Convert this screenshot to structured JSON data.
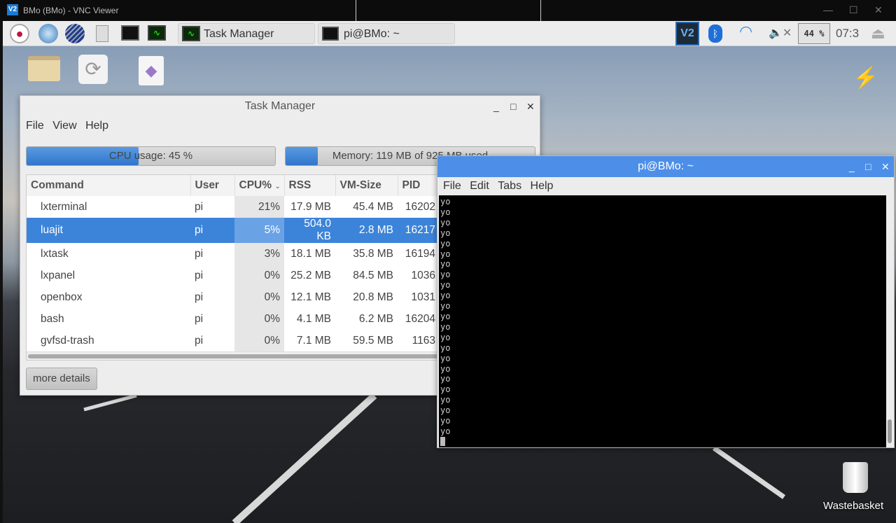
{
  "vnc": {
    "title": "BMo (BMo) - VNC Viewer",
    "icon": "V2",
    "min": "—",
    "max": "☐",
    "close": "✕"
  },
  "panel": {
    "launchers": [
      "raspberry-menu-icon",
      "web-browser-icon",
      "wolfram-icon",
      "file-manager-icon",
      "terminal-icon",
      "task-manager-icon"
    ],
    "tasks": [
      {
        "label": "Task Manager",
        "icon": "task-manager-icon"
      },
      {
        "label": "pi@BMo: ~",
        "icon": "terminal-icon"
      }
    ],
    "tray": {
      "vnc": "V2",
      "cpu_monitor": "44 %",
      "clock": "07:3"
    }
  },
  "taskmanager": {
    "title": "Task Manager",
    "menu": [
      "File",
      "View",
      "Help"
    ],
    "cpu_label": "CPU usage: 45 %",
    "cpu_percent": 45,
    "mem_label": "Memory: 119 MB of 925 MB used",
    "mem_percent": 13,
    "columns": [
      "Command",
      "User",
      "CPU%",
      "RSS",
      "VM-Size",
      "PID"
    ],
    "rows": [
      [
        "lxterminal",
        "pi",
        "21%",
        "17.9 MB",
        "45.4 MB",
        "16202"
      ],
      [
        "luajit",
        "pi",
        "5%",
        "504.0 KB",
        "2.8 MB",
        "16217"
      ],
      [
        "lxtask",
        "pi",
        "3%",
        "18.1 MB",
        "35.8 MB",
        "16194"
      ],
      [
        "lxpanel",
        "pi",
        "0%",
        "25.2 MB",
        "84.5 MB",
        "1036"
      ],
      [
        "openbox",
        "pi",
        "0%",
        "12.1 MB",
        "20.8 MB",
        "1031"
      ],
      [
        "bash",
        "pi",
        "0%",
        "4.1 MB",
        "6.2 MB",
        "16204"
      ],
      [
        "gvfsd-trash",
        "pi",
        "0%",
        "7.1 MB",
        "59.5 MB",
        "1163"
      ]
    ],
    "selected_row": 1,
    "more_details": "more details",
    "controls": {
      "min": "_",
      "max": "□",
      "close": "✕"
    }
  },
  "terminal": {
    "title": "pi@BMo: ~",
    "menu": [
      "File",
      "Edit",
      "Tabs",
      "Help"
    ],
    "lines": [
      "yo",
      "yo",
      "yo",
      "yo",
      "yo",
      "yo",
      "yo",
      "yo",
      "yo",
      "yo",
      "yo",
      "yo",
      "yo",
      "yo",
      "yo",
      "yo",
      "yo",
      "yo",
      "yo",
      "yo",
      "yo",
      "yo",
      "yo"
    ],
    "controls": {
      "min": "_",
      "max": "□",
      "close": "✕"
    }
  },
  "desktop": {
    "wastebasket": "Wastebasket"
  }
}
